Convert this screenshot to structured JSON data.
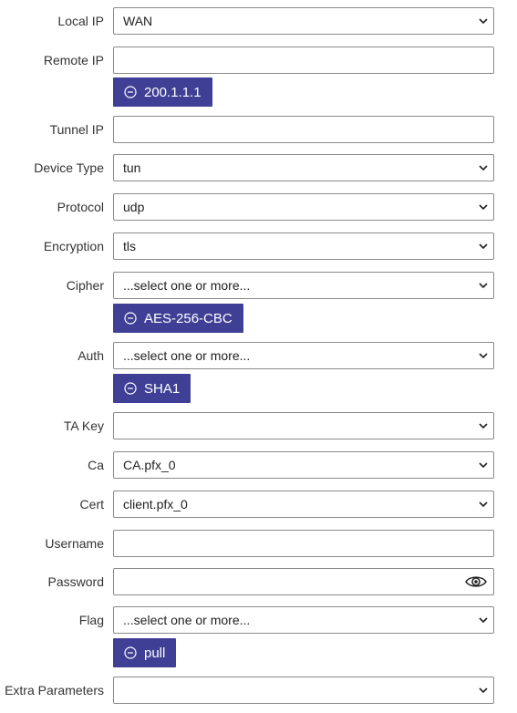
{
  "form": {
    "local_ip": {
      "label": "Local IP",
      "value": "WAN"
    },
    "remote_ip": {
      "label": "Remote IP",
      "value": "",
      "chips": [
        "200.1.1.1"
      ]
    },
    "tunnel_ip": {
      "label": "Tunnel IP",
      "value": ""
    },
    "device_type": {
      "label": "Device Type",
      "value": "tun"
    },
    "protocol": {
      "label": "Protocol",
      "value": "udp"
    },
    "encryption": {
      "label": "Encryption",
      "value": "tls"
    },
    "cipher": {
      "label": "Cipher",
      "value": "...select one or more...",
      "chips": [
        "AES-256-CBC"
      ]
    },
    "auth": {
      "label": "Auth",
      "value": "...select one or more...",
      "chips": [
        "SHA1"
      ]
    },
    "ta_key": {
      "label": "TA Key",
      "value": ""
    },
    "ca": {
      "label": "Ca",
      "value": "CA.pfx_0"
    },
    "cert": {
      "label": "Cert",
      "value": "client.pfx_0"
    },
    "username": {
      "label": "Username",
      "value": ""
    },
    "password": {
      "label": "Password",
      "value": ""
    },
    "flag": {
      "label": "Flag",
      "value": "...select one or more...",
      "chips": [
        "pull"
      ]
    },
    "extra_parameters": {
      "label": "Extra Parameters",
      "value": ""
    }
  },
  "icons": {
    "dropdown": "chevron-down-icon",
    "chip_remove": "minus-circle-icon",
    "password_toggle": "eye-icon"
  },
  "colors": {
    "chip_background": "#3f4095",
    "chip_text": "#ffffff",
    "border": "#8a8a8a"
  }
}
